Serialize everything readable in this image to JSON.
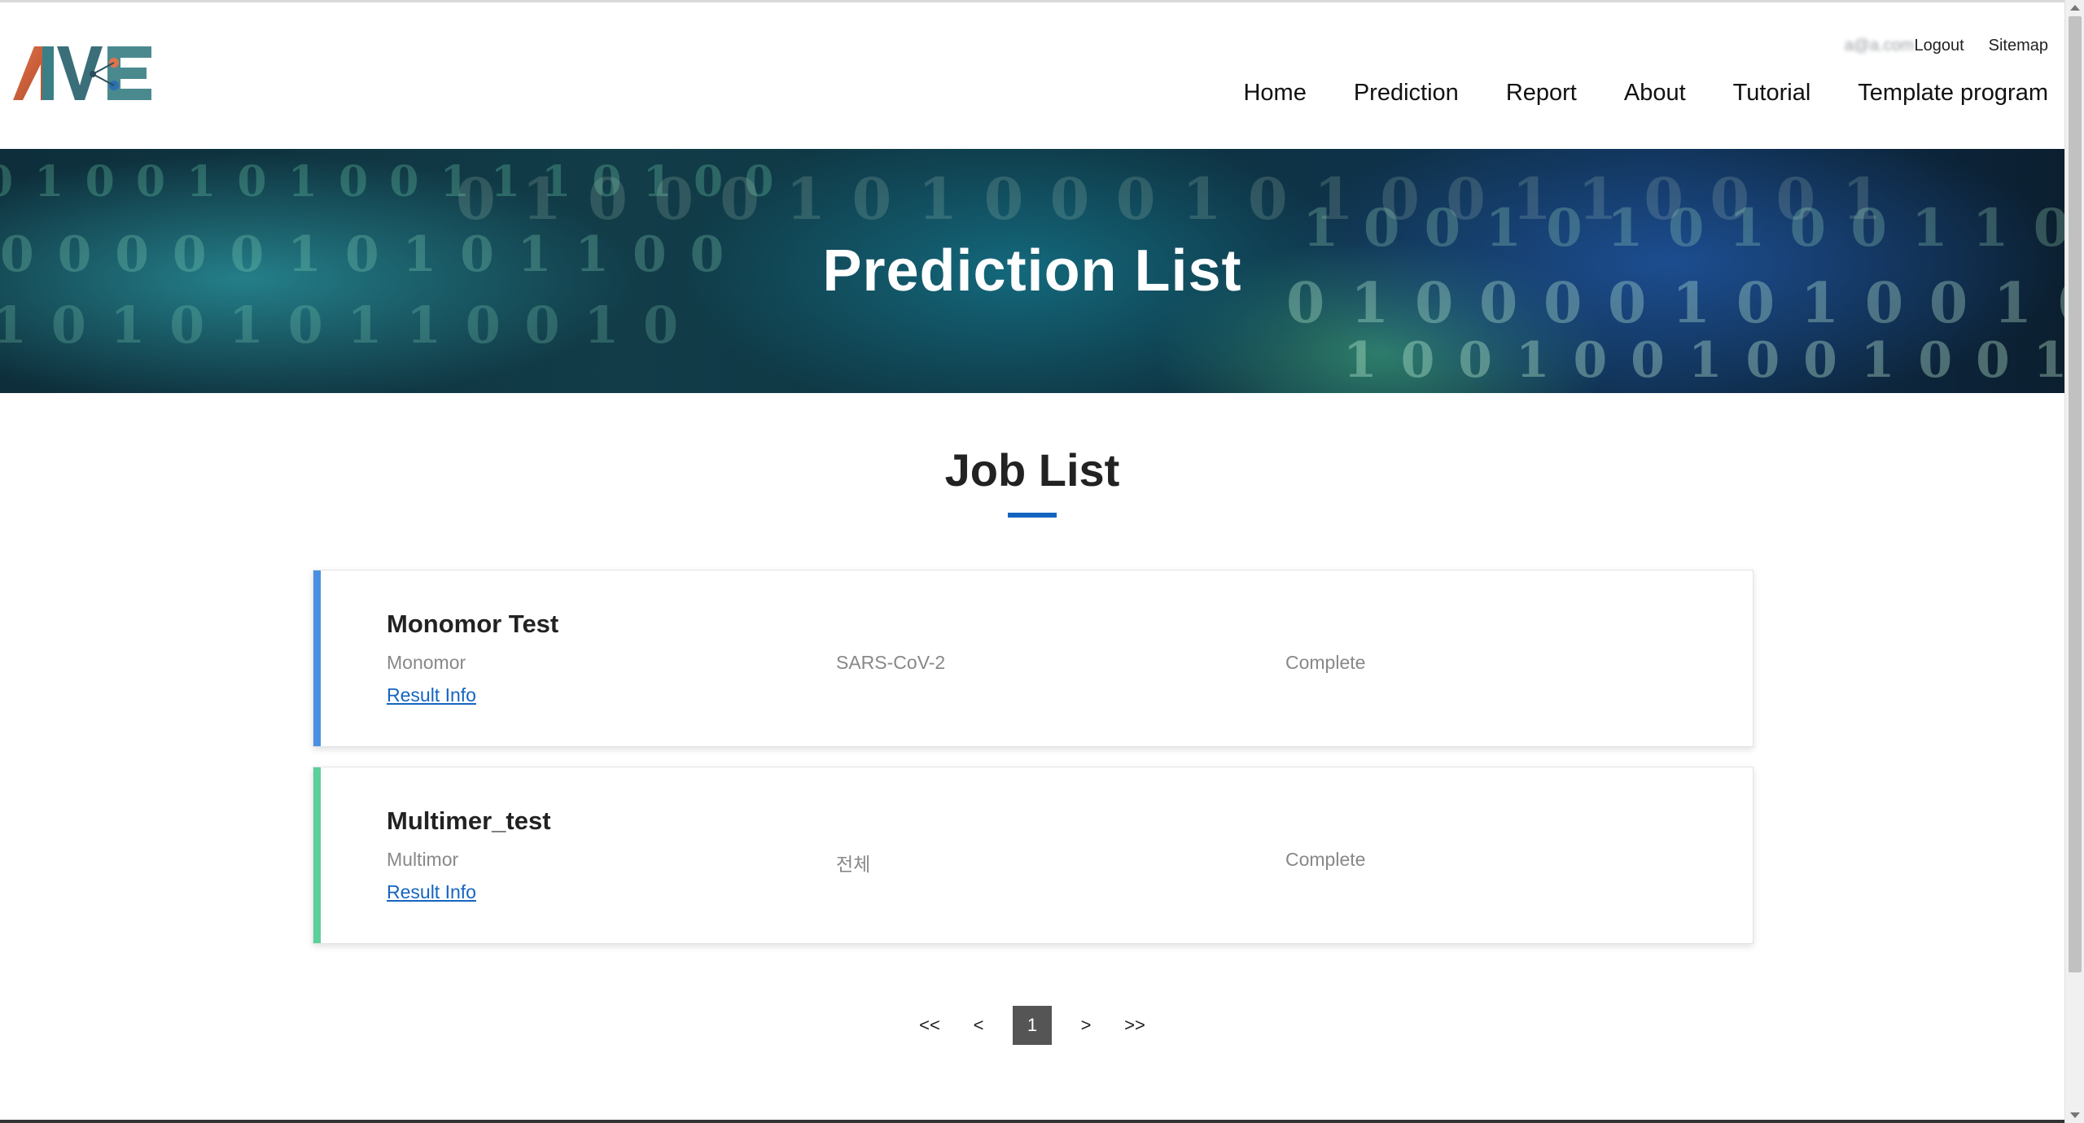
{
  "header": {
    "logo_text": "AIVE",
    "user_email": "a@a.com",
    "logout_label": "Logout",
    "sitemap_label": "Sitemap",
    "nav": [
      "Home",
      "Prediction",
      "Report",
      "About",
      "Tutorial",
      "Template program"
    ]
  },
  "banner": {
    "title": "Prediction List"
  },
  "main": {
    "section_title": "Job List",
    "jobs": [
      {
        "name": "Monomor Test",
        "type": "Monomor",
        "target": "SARS-CoV-2",
        "status": "Complete",
        "link_label": "Result Info",
        "accent_color": "#4a90e2"
      },
      {
        "name": "Multimer_test",
        "type": "Multimor",
        "target": "전체",
        "status": "Complete",
        "link_label": "Result Info",
        "accent_color": "#5ccf9a"
      }
    ]
  },
  "pagination": {
    "first": "<<",
    "prev": "<",
    "current": "1",
    "next": ">",
    "last": ">>"
  },
  "colors": {
    "accent": "#1565c0",
    "active_page_bg": "#555555"
  }
}
